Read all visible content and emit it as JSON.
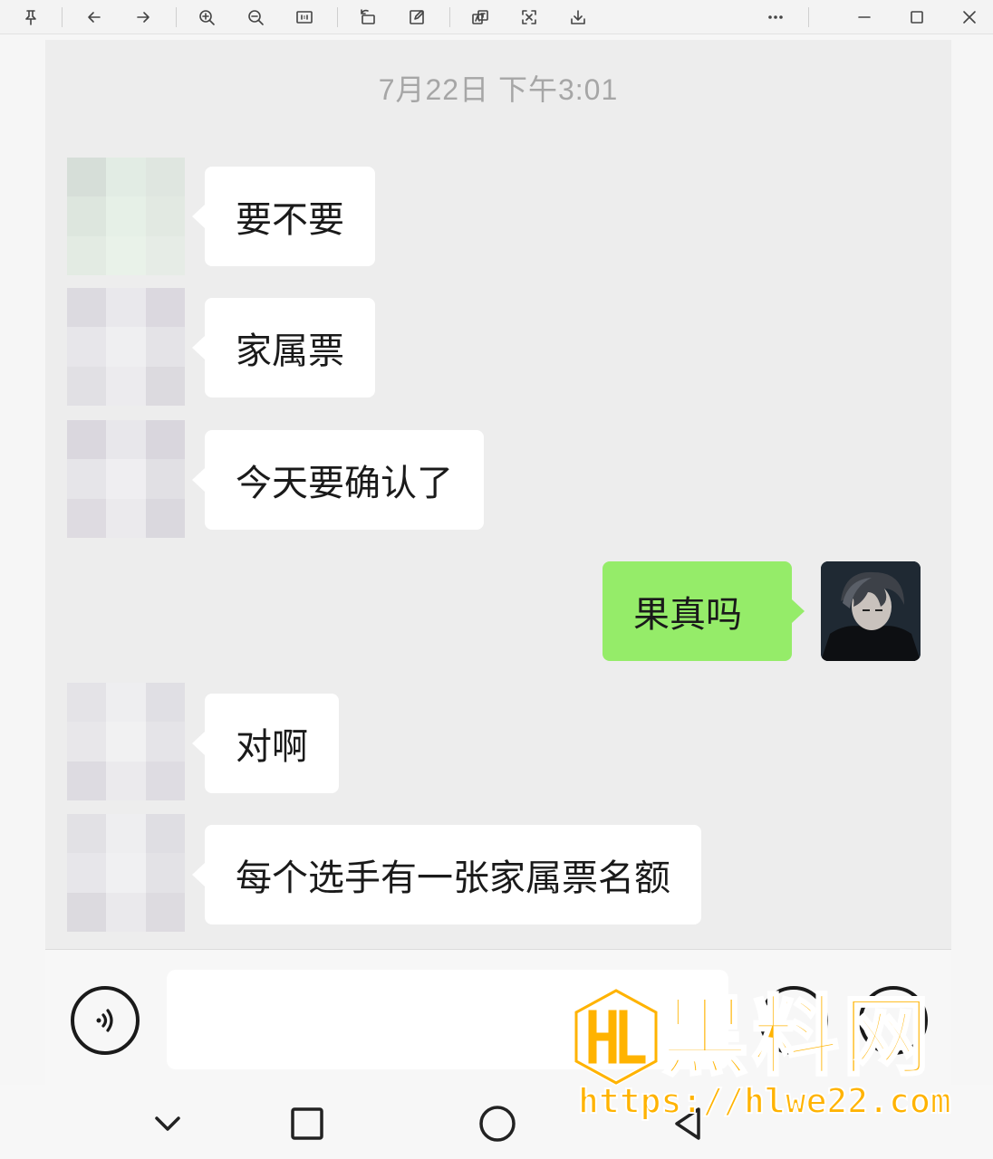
{
  "toolbar": {
    "icons": [
      "pin-icon",
      "back-arrow-icon",
      "forward-arrow-icon",
      "zoom-in-icon",
      "zoom-out-icon",
      "actual-size-icon",
      "rotate-icon",
      "edit-icon",
      "translate-icon",
      "screenshot-icon",
      "download-icon",
      "more-icon",
      "minimize-icon",
      "maximize-icon",
      "close-icon"
    ]
  },
  "chat": {
    "timestamp": "7月22日 下午3:01",
    "messages": [
      {
        "direction": "in",
        "text": "要不要"
      },
      {
        "direction": "in",
        "text": "家属票"
      },
      {
        "direction": "in",
        "text": "今天要确认了"
      },
      {
        "direction": "out",
        "text": "果真吗"
      },
      {
        "direction": "in",
        "text": "对啊"
      },
      {
        "direction": "in",
        "text": "每个选手有一张家属票名额"
      }
    ],
    "colors": {
      "background": "#ededed",
      "incoming_bubble": "#ffffff",
      "outgoing_bubble": "#95ec69"
    }
  },
  "inputbar": {
    "icons": [
      "voice-icon",
      "emoji-icon",
      "add-icon"
    ]
  },
  "navbar": {
    "icons": [
      "collapse-chevron-icon",
      "recents-icon",
      "home-icon",
      "back-icon"
    ]
  },
  "watermark": {
    "title": "黑料网",
    "url": "https://hlwe22.com",
    "color": "#ffb300"
  }
}
